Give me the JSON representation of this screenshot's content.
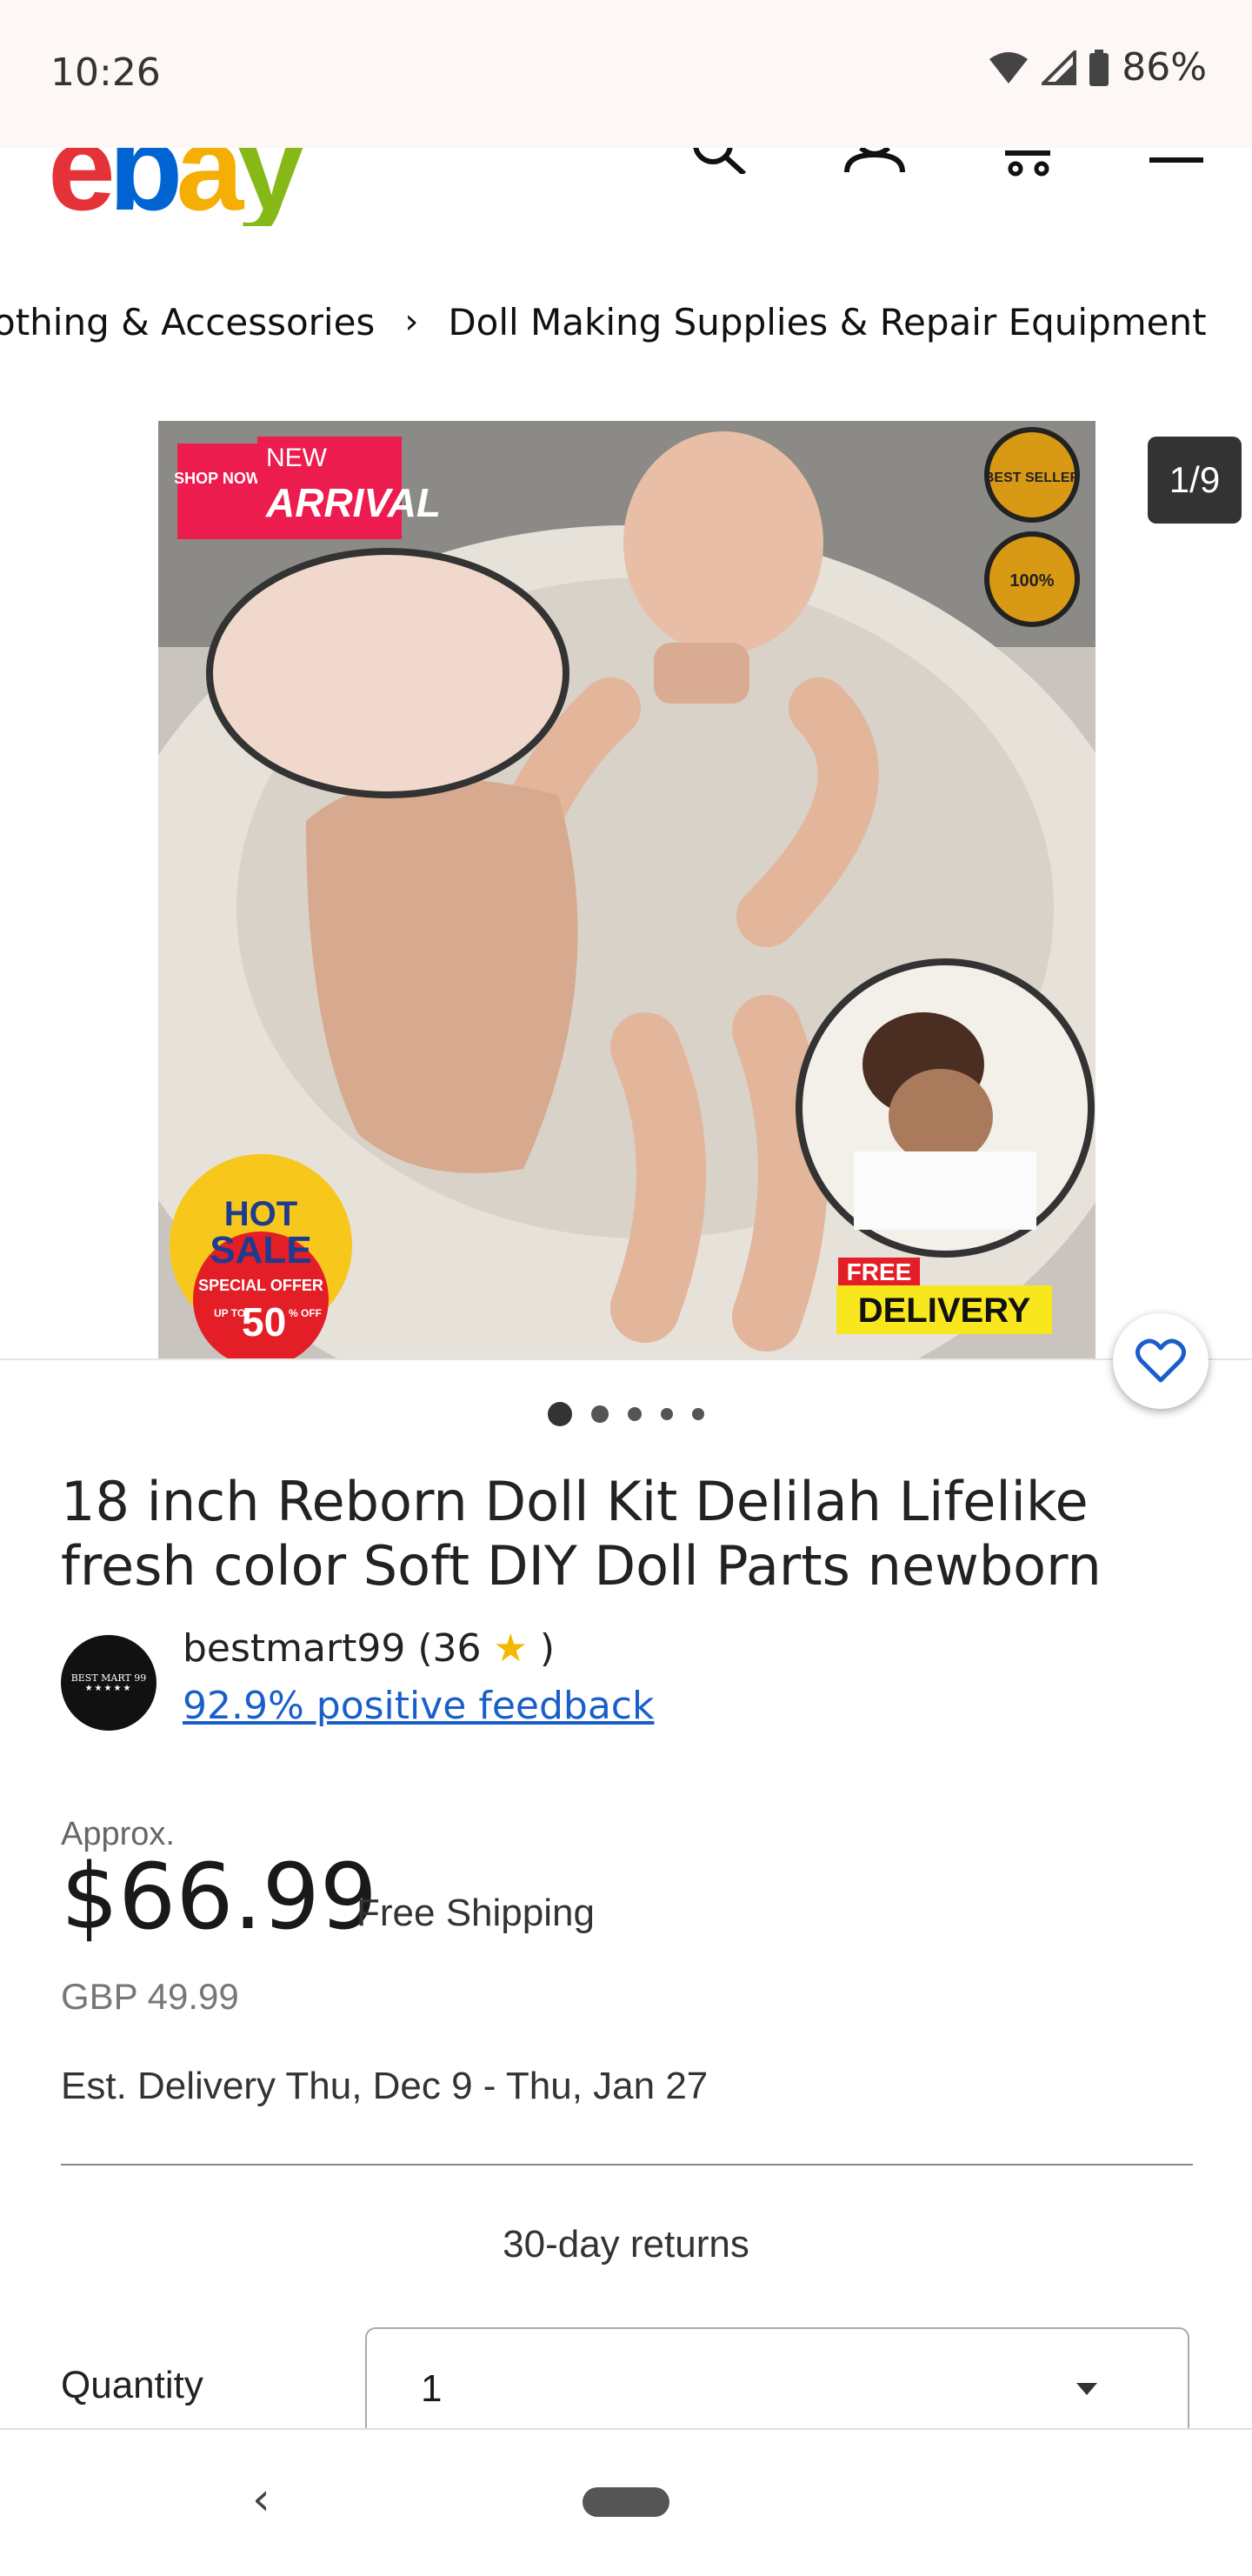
{
  "status": {
    "time": "10:26",
    "battery": "86%"
  },
  "header": {
    "logo_letters": [
      "e",
      "b",
      "a",
      "y"
    ],
    "logo_colors": [
      "#e53238",
      "#0064d2",
      "#f5af02",
      "#86b817"
    ]
  },
  "breadcrumb": {
    "items": [
      "othing & Accessories",
      "Doll Making Supplies & Repair Equipment"
    ],
    "separator": "›"
  },
  "gallery": {
    "counter": "1/9",
    "badges": {
      "shop_now": "SHOP NOW",
      "new": "NEW",
      "arrival": "ARRIVAL",
      "best_seller": "BEST SELLER",
      "hundred": "100%",
      "hot": "HOT",
      "sale": "SALE",
      "special_offer": "SPECIAL OFFER",
      "upto": "UP TO",
      "fifty": "50",
      "off": "% OFF",
      "free": "FREE",
      "delivery": "DELIVERY"
    },
    "dots_total": 5,
    "active_dot": 0
  },
  "product": {
    "title": "18 inch Reborn Doll Kit Delilah Lifelike fresh color Soft DIY Doll Parts newborn"
  },
  "seller": {
    "avatar_text": "BEST MART 99",
    "name": "bestmart99 (36",
    "name_close": " )",
    "feedback": "92.9% positive feedback"
  },
  "pricing": {
    "approx_label": "Approx.",
    "price": "$66.99",
    "shipping": "Free Shipping",
    "original": "GBP 49.99",
    "delivery": "Est. Delivery Thu, Dec 9 - Thu, Jan 27"
  },
  "returns": "30-day returns",
  "quantity": {
    "label": "Quantity",
    "value": "1"
  },
  "colors": {
    "link": "#1a5fc9",
    "dark_chip": "#333333"
  }
}
